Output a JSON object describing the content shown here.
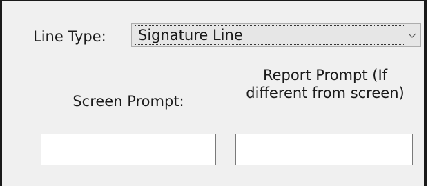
{
  "line_type": {
    "label": "Line Type:",
    "selected_value": "Signature Line"
  },
  "screen_prompt": {
    "label": "Screen Prompt:",
    "value": ""
  },
  "report_prompt": {
    "label_line1": "Report Prompt (If",
    "label_line2": "different from screen)",
    "value": ""
  }
}
